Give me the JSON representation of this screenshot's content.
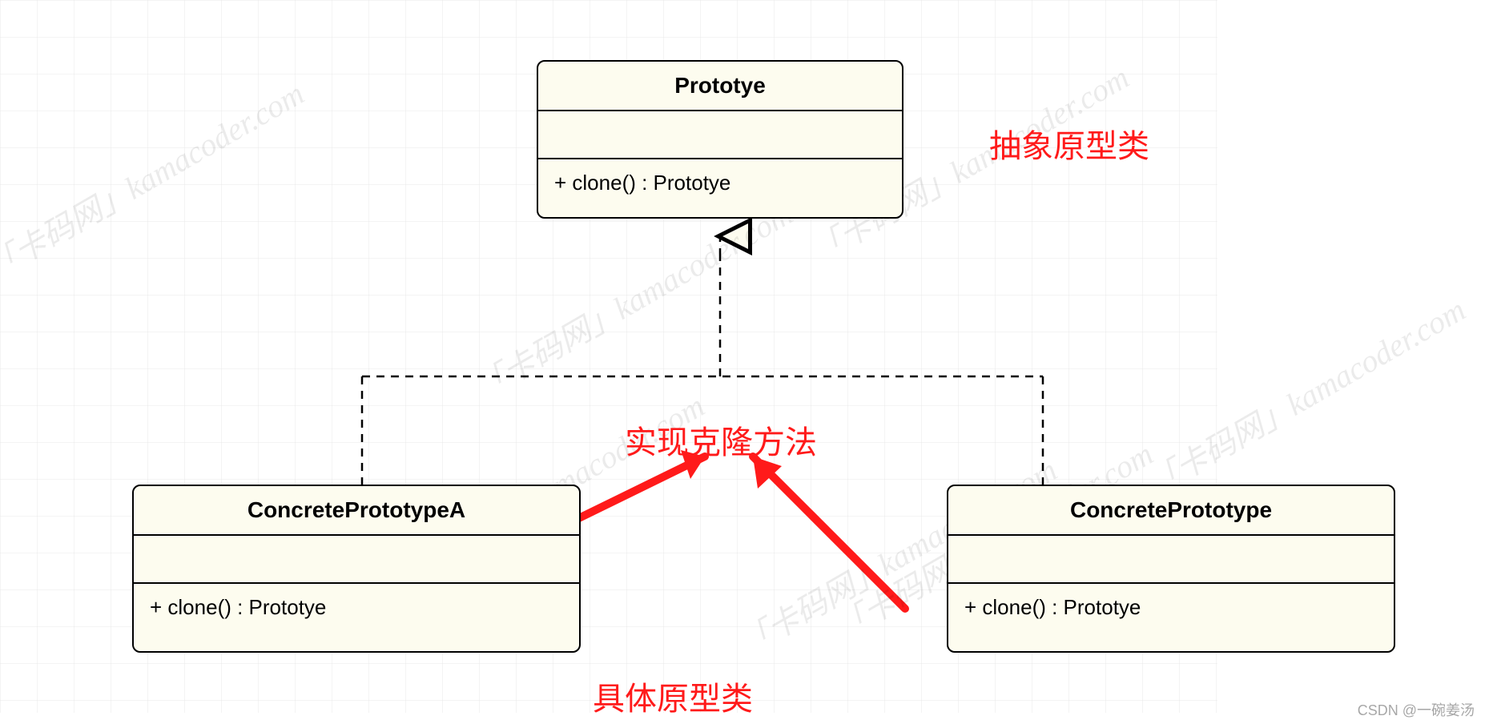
{
  "classes": {
    "prototype": {
      "name": "Prototye",
      "operation": "+ clone() : Prototye"
    },
    "concreteA": {
      "name": "ConcretePrototypeA",
      "operation": "+ clone() : Prototye"
    },
    "concreteB": {
      "name": "ConcretePrototype",
      "operation": "+ clone() : Prototye"
    }
  },
  "annotations": {
    "abstract_class": "抽象原型类",
    "implements_clone": "实现克隆方法",
    "concrete_class": "具体原型类"
  },
  "watermark": "「卡码网」kamacoder.com",
  "credit": "CSDN @一碗姜汤"
}
